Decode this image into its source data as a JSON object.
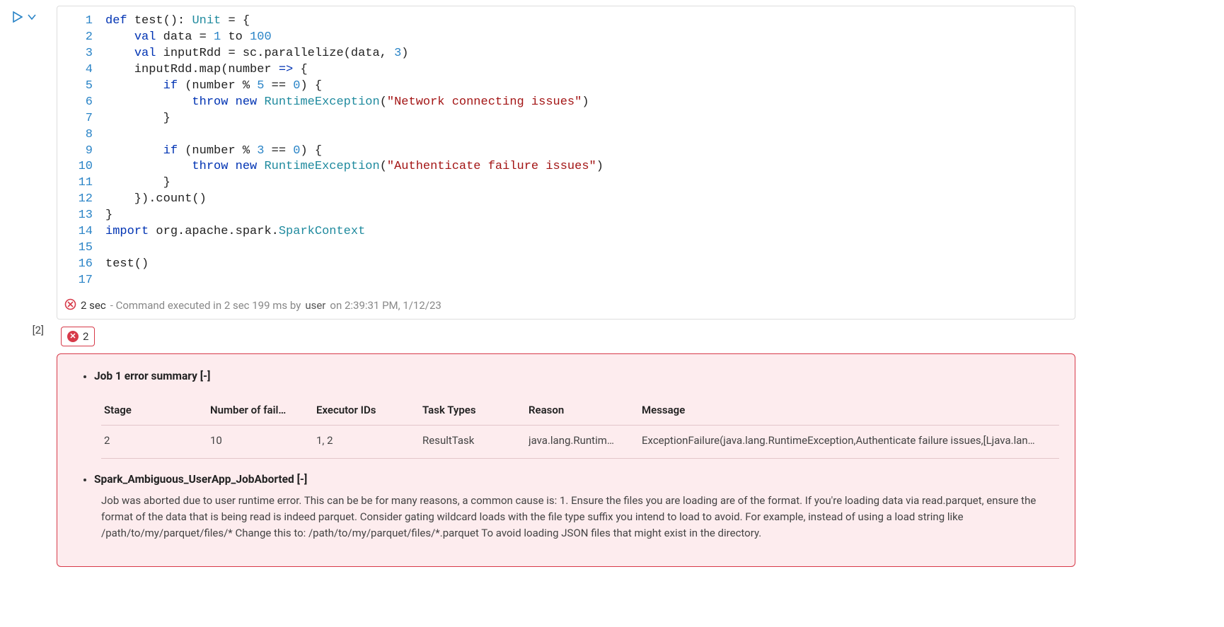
{
  "cell": {
    "index_label": "[2]",
    "gutter": [
      "1",
      "2",
      "3",
      "4",
      "5",
      "6",
      "7",
      "8",
      "9",
      "10",
      "11",
      "12",
      "13",
      "14",
      "15",
      "16",
      "17"
    ],
    "code_tokens": [
      [
        [
          "kw",
          "def"
        ],
        [
          "",
          " "
        ],
        [
          "ident",
          "test"
        ],
        [
          "",
          "(): "
        ],
        [
          "type",
          "Unit"
        ],
        [
          "",
          " = {"
        ]
      ],
      [
        [
          "",
          "    "
        ],
        [
          "kw",
          "val"
        ],
        [
          "",
          " data = "
        ],
        [
          "num",
          "1"
        ],
        [
          "",
          " to "
        ],
        [
          "num",
          "100"
        ]
      ],
      [
        [
          "",
          "    "
        ],
        [
          "kw",
          "val"
        ],
        [
          "",
          " inputRdd = sc.parallelize(data, "
        ],
        [
          "num",
          "3"
        ],
        [
          "",
          ")"
        ]
      ],
      [
        [
          "",
          "    inputRdd.map(number "
        ],
        [
          "kw",
          "=>"
        ],
        [
          "",
          " {"
        ]
      ],
      [
        [
          "",
          "        "
        ],
        [
          "kw",
          "if"
        ],
        [
          "",
          " (number % "
        ],
        [
          "num",
          "5"
        ],
        [
          "",
          " == "
        ],
        [
          "num",
          "0"
        ],
        [
          "",
          ") {"
        ]
      ],
      [
        [
          "",
          "            "
        ],
        [
          "kw",
          "throw"
        ],
        [
          "",
          " "
        ],
        [
          "kw",
          "new"
        ],
        [
          "",
          " "
        ],
        [
          "type",
          "RuntimeException"
        ],
        [
          "",
          "("
        ],
        [
          "str",
          "\"Network connecting issues\""
        ],
        [
          "",
          ")"
        ]
      ],
      [
        [
          "",
          "        }"
        ]
      ],
      [
        [
          "",
          ""
        ]
      ],
      [
        [
          "",
          "        "
        ],
        [
          "kw",
          "if"
        ],
        [
          "",
          " (number % "
        ],
        [
          "num",
          "3"
        ],
        [
          "",
          " == "
        ],
        [
          "num",
          "0"
        ],
        [
          "",
          ") {"
        ]
      ],
      [
        [
          "",
          "            "
        ],
        [
          "kw",
          "throw"
        ],
        [
          "",
          " "
        ],
        [
          "kw",
          "new"
        ],
        [
          "",
          " "
        ],
        [
          "type",
          "RuntimeException"
        ],
        [
          "",
          "("
        ],
        [
          "str",
          "\"Authenticate failure issues\""
        ],
        [
          "",
          ")"
        ]
      ],
      [
        [
          "",
          "        }"
        ]
      ],
      [
        [
          "",
          "    }).count()"
        ]
      ],
      [
        [
          "",
          "}"
        ]
      ],
      [
        [
          "kw",
          "import"
        ],
        [
          "",
          " org.apache.spark."
        ],
        [
          "type",
          "SparkContext"
        ]
      ],
      [
        [
          "",
          ""
        ]
      ],
      [
        [
          "",
          "test()"
        ]
      ],
      [
        [
          "",
          ""
        ]
      ]
    ],
    "status": {
      "duration": "2 sec",
      "sub": " - Command executed in 2 sec 199 ms by ",
      "user": "user",
      "timestamp": "   on 2:39:31 PM, 1/12/23"
    }
  },
  "error": {
    "count": "2",
    "items": {
      "job_summary": {
        "title": "Job 1 error summary [-]",
        "columns": [
          "Stage",
          "Number of fail…",
          "Executor IDs",
          "Task Types",
          "Reason",
          "Message"
        ],
        "row": {
          "stage": "2",
          "num_failed": "10",
          "executor_ids": "1, 2",
          "task_types": "ResultTask",
          "reason": "java.lang.Runtim…",
          "message": "ExceptionFailure(java.lang.RuntimeException,Authenticate failure issues,[Ljava.lan…"
        }
      },
      "aborted": {
        "title": "Spark_Ambiguous_UserApp_JobAborted [-]",
        "description": "Job was aborted due to user runtime error. This can be be for many reasons, a common cause is: 1. Ensure the files you are loading are of the format. If you're loading data via read.parquet, ensure the format of the data that is being read is indeed parquet. Consider gating wildcard loads with the file type suffix you intend to load to avoid. For example, instead of using a load string like /path/to/my/parquet/files/* Change this to: /path/to/my/parquet/files/*.parquet To avoid loading JSON files that might exist in the directory."
      }
    }
  }
}
